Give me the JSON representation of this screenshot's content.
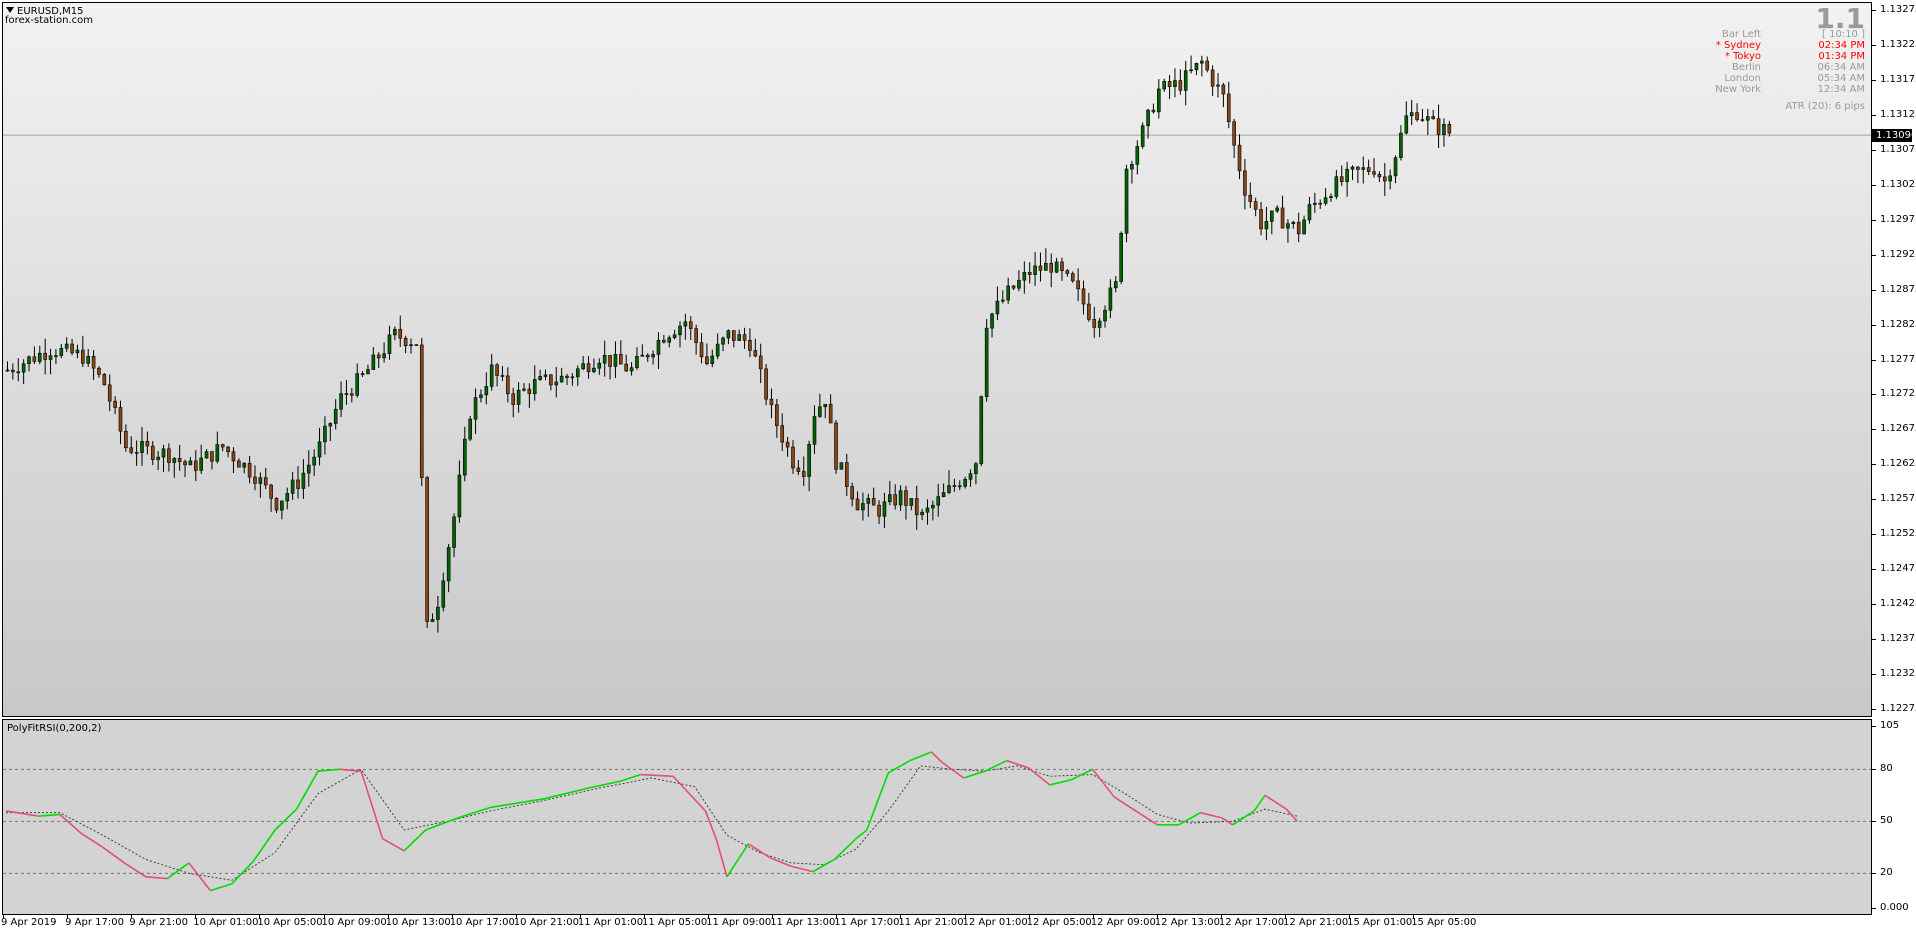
{
  "window": {
    "symbol_title": "EURUSD,M15",
    "broker": "forex-station.com",
    "menu_icon": "triangle-down-icon"
  },
  "info_panel": {
    "big_value": "1.1",
    "rows": [
      {
        "label": "Bar Left",
        "value": "[ 10:10 ]",
        "color": "#9a9a9a"
      },
      {
        "label": "* Sydney",
        "value": "02:34 PM",
        "color": "#ff0000"
      },
      {
        "label": "* Tokyo",
        "value": "01:34 PM",
        "color": "#ff0000"
      },
      {
        "label": "Berlin",
        "value": "06:34 AM",
        "color": "#9a9a9a"
      },
      {
        "label": "London",
        "value": "05:34 AM",
        "color": "#9a9a9a"
      },
      {
        "label": "New York",
        "value": "12:34 AM",
        "color": "#9a9a9a"
      }
    ],
    "atr": "ATR (20): 6 pips"
  },
  "price_axis": {
    "labels": [
      "1.13275",
      "1.13225",
      "1.13175",
      "1.13125",
      "1.13075",
      "1.13025",
      "1.12975",
      "1.12925",
      "1.12875",
      "1.12825",
      "1.12775",
      "1.12725",
      "1.12675",
      "1.12625",
      "1.12575",
      "1.12525",
      "1.12475",
      "1.12425",
      "1.12375",
      "1.12325",
      "1.12275"
    ],
    "current_price": "1.13096"
  },
  "indicator": {
    "title": "PolyFitRSI(0,200,2)",
    "axis_labels": [
      "105",
      "80",
      "50",
      "20",
      "0.000"
    ],
    "levels": [
      80,
      50,
      20
    ],
    "up_color": "#00dd00",
    "down_color": "#e0507a",
    "signal_color": "#404040"
  },
  "time_axis": {
    "labels": [
      "9 Apr 2019",
      "9 Apr 17:00",
      "9 Apr 21:00",
      "10 Apr 01:00",
      "10 Apr 05:00",
      "10 Apr 09:00",
      "10 Apr 13:00",
      "10 Apr 17:00",
      "10 Apr 21:00",
      "11 Apr 01:00",
      "11 Apr 05:00",
      "11 Apr 09:00",
      "11 Apr 13:00",
      "11 Apr 17:00",
      "11 Apr 21:00",
      "12 Apr 01:00",
      "12 Apr 05:00",
      "12 Apr 09:00",
      "12 Apr 13:00",
      "12 Apr 17:00",
      "12 Apr 21:00",
      "15 Apr 01:00",
      "15 Apr 05:00"
    ]
  },
  "chart_data": [
    {
      "type": "candlestick",
      "title": "EURUSD,M15",
      "ylim": [
        1.12265,
        1.13285
      ],
      "bull_color": "#006400",
      "bear_color": "#8b4513",
      "close_path": [
        [
          0,
          1.1276
        ],
        [
          8,
          1.1279
        ],
        [
          14,
          1.1278
        ],
        [
          18,
          1.1274
        ],
        [
          22,
          1.1265
        ],
        [
          30,
          1.1264
        ],
        [
          34,
          1.1262
        ],
        [
          40,
          1.1265
        ],
        [
          46,
          1.1261
        ],
        [
          50,
          1.1257
        ],
        [
          54,
          1.126
        ],
        [
          58,
          1.1265
        ],
        [
          62,
          1.1272
        ],
        [
          66,
          1.1275
        ],
        [
          72,
          1.1281
        ],
        [
          76,
          1.128
        ],
        [
          77,
          1.126
        ],
        [
          78,
          1.1239
        ],
        [
          80,
          1.1243
        ],
        [
          83,
          1.1255
        ],
        [
          86,
          1.127
        ],
        [
          90,
          1.1276
        ],
        [
          94,
          1.1272
        ],
        [
          98,
          1.1274
        ],
        [
          104,
          1.1275
        ],
        [
          110,
          1.1278
        ],
        [
          116,
          1.1276
        ],
        [
          122,
          1.1281
        ],
        [
          126,
          1.1283
        ],
        [
          130,
          1.1277
        ],
        [
          134,
          1.1281
        ],
        [
          138,
          1.128
        ],
        [
          142,
          1.127
        ],
        [
          146,
          1.1263
        ],
        [
          148,
          1.1262
        ],
        [
          150,
          1.127
        ],
        [
          152,
          1.1272
        ],
        [
          154,
          1.1263
        ],
        [
          158,
          1.1257
        ],
        [
          162,
          1.1256
        ],
        [
          166,
          1.1258
        ],
        [
          170,
          1.1255
        ],
        [
          174,
          1.1258
        ],
        [
          178,
          1.1261
        ],
        [
          180,
          1.1263
        ],
        [
          182,
          1.1283
        ],
        [
          186,
          1.1287
        ],
        [
          190,
          1.129
        ],
        [
          194,
          1.1291
        ],
        [
          198,
          1.1288
        ],
        [
          202,
          1.1283
        ],
        [
          206,
          1.1288
        ],
        [
          208,
          1.1305
        ],
        [
          211,
          1.131
        ],
        [
          214,
          1.1316
        ],
        [
          218,
          1.1317
        ],
        [
          222,
          1.132
        ],
        [
          226,
          1.1315
        ],
        [
          228,
          1.1308
        ],
        [
          230,
          1.1302
        ],
        [
          233,
          1.1297
        ],
        [
          236,
          1.1298
        ],
        [
          240,
          1.1296
        ],
        [
          242,
          1.1299
        ],
        [
          246,
          1.1302
        ],
        [
          250,
          1.1304
        ],
        [
          254,
          1.1305
        ],
        [
          256,
          1.1303
        ],
        [
          258,
          1.1307
        ],
        [
          260,
          1.1312
        ],
        [
          262,
          1.1313
        ],
        [
          265,
          1.1311
        ],
        [
          268,
          1.131
        ]
      ],
      "rsi_path": [
        [
          0,
          56
        ],
        [
          6,
          53
        ],
        [
          10,
          54
        ],
        [
          14,
          43
        ],
        [
          18,
          35
        ],
        [
          22,
          26
        ],
        [
          26,
          18
        ],
        [
          30,
          17
        ],
        [
          34,
          26
        ],
        [
          38,
          10
        ],
        [
          42,
          14
        ],
        [
          46,
          27
        ],
        [
          50,
          45
        ],
        [
          54,
          57
        ],
        [
          58,
          79
        ],
        [
          62,
          80
        ],
        [
          66,
          79
        ],
        [
          70,
          40
        ],
        [
          74,
          33
        ],
        [
          78,
          45
        ],
        [
          84,
          52
        ],
        [
          90,
          58
        ],
        [
          100,
          63
        ],
        [
          108,
          69
        ],
        [
          114,
          73
        ],
        [
          118,
          77
        ],
        [
          124,
          76
        ],
        [
          130,
          56
        ],
        [
          132,
          40
        ],
        [
          134,
          18
        ],
        [
          138,
          37
        ],
        [
          142,
          29
        ],
        [
          146,
          24
        ],
        [
          150,
          21
        ],
        [
          154,
          28
        ],
        [
          158,
          40
        ],
        [
          160,
          45
        ],
        [
          164,
          78
        ],
        [
          168,
          85
        ],
        [
          172,
          90
        ],
        [
          174,
          84
        ],
        [
          178,
          75
        ],
        [
          182,
          79
        ],
        [
          186,
          85
        ],
        [
          190,
          81
        ],
        [
          194,
          71
        ],
        [
          198,
          74
        ],
        [
          202,
          80
        ],
        [
          206,
          64
        ],
        [
          210,
          56
        ],
        [
          214,
          48
        ],
        [
          218,
          48
        ],
        [
          222,
          55
        ],
        [
          226,
          52
        ],
        [
          228,
          48
        ],
        [
          232,
          56
        ],
        [
          234,
          65
        ],
        [
          238,
          57
        ],
        [
          240,
          50
        ]
      ],
      "signal_path": [
        [
          0,
          55
        ],
        [
          10,
          55
        ],
        [
          18,
          42
        ],
        [
          26,
          28
        ],
        [
          34,
          20
        ],
        [
          42,
          16
        ],
        [
          50,
          32
        ],
        [
          58,
          66
        ],
        [
          66,
          80
        ],
        [
          74,
          45
        ],
        [
          82,
          50
        ],
        [
          90,
          56
        ],
        [
          100,
          62
        ],
        [
          110,
          69
        ],
        [
          120,
          75
        ],
        [
          128,
          70
        ],
        [
          134,
          42
        ],
        [
          140,
          32
        ],
        [
          146,
          26
        ],
        [
          152,
          25
        ],
        [
          158,
          34
        ],
        [
          164,
          56
        ],
        [
          170,
          82
        ],
        [
          176,
          80
        ],
        [
          182,
          79
        ],
        [
          188,
          82
        ],
        [
          194,
          76
        ],
        [
          202,
          77
        ],
        [
          208,
          66
        ],
        [
          214,
          54
        ],
        [
          220,
          49
        ],
        [
          228,
          50
        ],
        [
          234,
          57
        ],
        [
          240,
          53
        ]
      ]
    }
  ]
}
